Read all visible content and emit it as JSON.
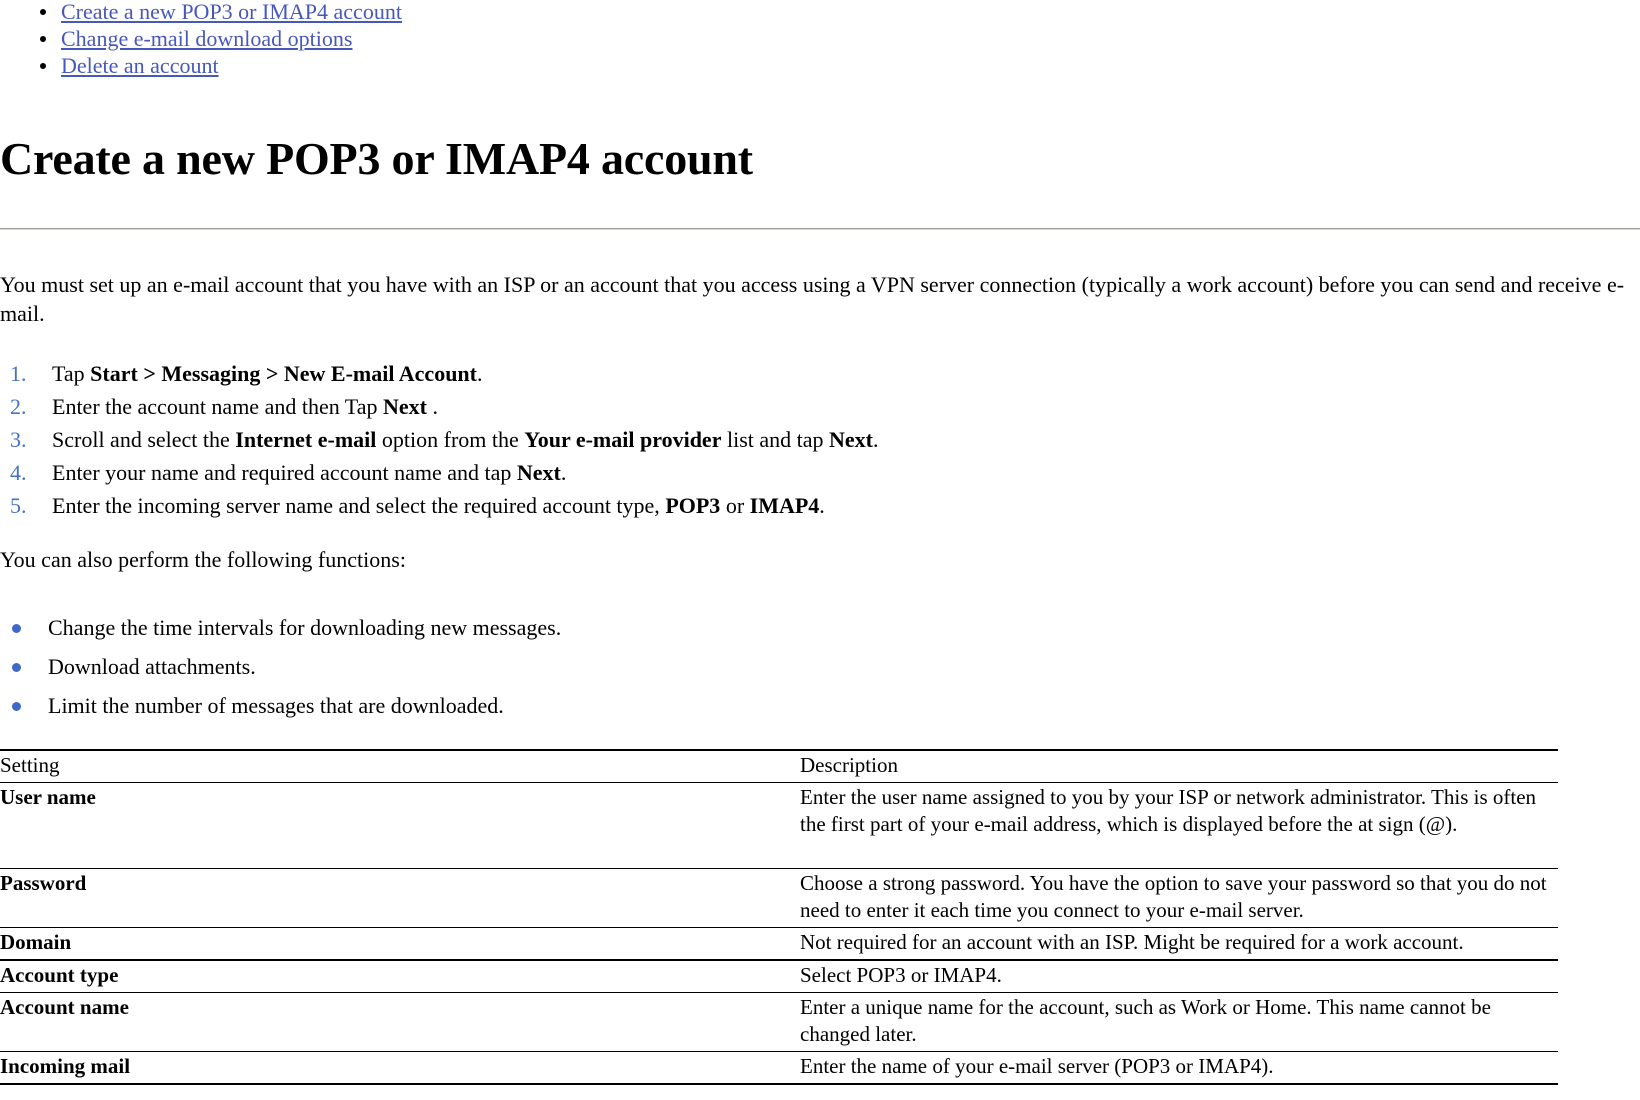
{
  "toc": {
    "links": [
      "Create a new POP3 or IMAP4 account",
      "Change e-mail download options",
      "Delete an account"
    ]
  },
  "heading": "Create a new POP3 or IMAP4 account",
  "intro": "You must set up an e-mail account that you have with an ISP or an account that you access using a VPN server connection (typically a work account) before you can send and receive e-mail.",
  "steps": [
    {
      "num": "1.",
      "text": "Tap Start > Messaging > New E-mail Account."
    },
    {
      "num": "2.",
      "text": "Enter the account name and then Tap Next ."
    },
    {
      "num": "3.",
      "text": "Scroll and select the Internet e-mail option from the Your e-mail provider list and tap Next."
    },
    {
      "num": "4.",
      "text": "Enter your name and required account name and tap Next."
    },
    {
      "num": "5.",
      "text": "Enter the incoming server name and select the required account type, POP3 or IMAP4."
    }
  ],
  "mid_paragraph": "You can also perform the following functions:",
  "functions": [
    "Change the time intervals for downloading new messages.",
    "Download attachments.",
    "Limit the number of messages that are downloaded."
  ],
  "table": {
    "headers": [
      "Setting",
      "Description"
    ],
    "rows": [
      {
        "setting": "User name",
        "description": "Enter the user name assigned to you by your ISP or network administrator. This is often the first part of your e-mail address, which is displayed before the at sign (@)."
      },
      {
        "setting": "Password",
        "description": "Choose a strong password. You have the option to save your password so that you do not need to enter it each time you connect to your e-mail server."
      },
      {
        "setting": "Domain",
        "description": "Not required for an account with an ISP. Might be required for a work account."
      },
      {
        "setting": "Account type",
        "description": "Select POP3 or IMAP4."
      },
      {
        "setting": "Account name",
        "description": "Enter a unique name for the account, such as Work or Home. This name cannot be changed later."
      },
      {
        "setting": "Incoming mail",
        "description": "Enter the name of your e-mail server (POP3 or IMAP4)."
      }
    ]
  },
  "colors": {
    "link": "#4758bd",
    "step_number": "#4472c4",
    "bullet_blue": "#3d67c9",
    "rule": "#9e9e99"
  }
}
